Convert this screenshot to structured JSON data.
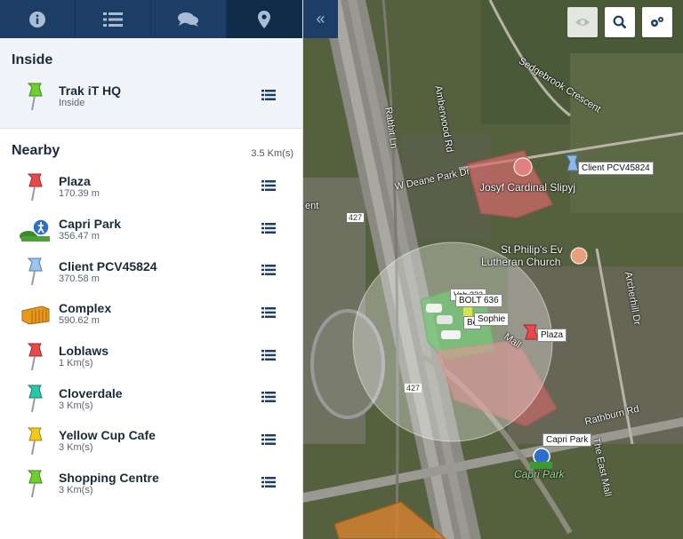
{
  "tabs": [
    {
      "name": "info",
      "icon": "info-icon"
    },
    {
      "name": "list",
      "icon": "list-icon"
    },
    {
      "name": "chat",
      "icon": "chat-icon"
    },
    {
      "name": "location",
      "icon": "map-marker-icon",
      "active": true
    }
  ],
  "collapse_label": "«",
  "inside": {
    "title": "Inside",
    "items": [
      {
        "name": "Trak iT HQ",
        "sub": "Inside",
        "icon": "pin-green"
      }
    ]
  },
  "nearby": {
    "title": "Nearby",
    "range": "3.5 Km(s)",
    "items": [
      {
        "name": "Plaza",
        "sub": "170.39 m",
        "icon": "pin-red"
      },
      {
        "name": "Capri Park",
        "sub": "356.47 m",
        "icon": "park-icon"
      },
      {
        "name": "Client PCV45824",
        "sub": "370.58 m",
        "icon": "pin-blue"
      },
      {
        "name": "Complex",
        "sub": "590.62 m",
        "icon": "container-icon"
      },
      {
        "name": "Loblaws",
        "sub": "1 Km(s)",
        "icon": "pin-red"
      },
      {
        "name": "Cloverdale",
        "sub": "3 Km(s)",
        "icon": "pin-teal"
      },
      {
        "name": "Yellow Cup Cafe",
        "sub": "3 Km(s)",
        "icon": "pin-yellow"
      },
      {
        "name": "Shopping Centre",
        "sub": "3 Km(s)",
        "icon": "pin-green"
      }
    ]
  },
  "map": {
    "buttons": [
      {
        "name": "visibility",
        "icon": "eye-icon"
      },
      {
        "name": "search",
        "icon": "search-icon"
      },
      {
        "name": "settings",
        "icon": "gears-icon"
      }
    ],
    "labels": {
      "client": "Client PCV45824",
      "bolt": "BOLT 636",
      "sophie": "Sophie",
      "veh": "Veh 332",
      "bo": "Bo",
      "plaza": "Plaza",
      "capri": "Capri Park"
    },
    "streets": {
      "sedgebrook": "Sedgebrook Crescent",
      "amberwood": "Amberwood Rd",
      "rabbit": "Rabbit Ln",
      "deane": "W Deane Park Dr",
      "archerhill": "Archerhill Dr",
      "rathburn": "Rathburn Rd",
      "eastmall": "The East Mall",
      "mall": "Mall",
      "hwy1": "427",
      "hwy2": "427",
      "ent": "ent"
    },
    "pois": {
      "school": "Josyf Cardinal Slipyj",
      "church1": "St Philip's Ev",
      "church2": "Lutheran Church",
      "park": "Capri Park"
    },
    "colors": {
      "navy": "#1c3d66",
      "red": "#e53d3d",
      "green": "#3cb34a",
      "blue": "#8fb8e8",
      "yellow": "#f2c318",
      "teal": "#25c0a6"
    }
  }
}
